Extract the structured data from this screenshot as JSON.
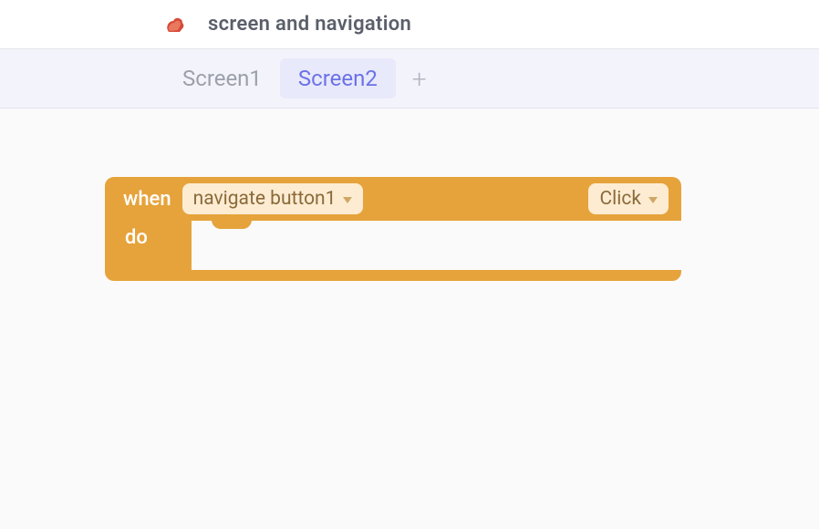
{
  "header": {
    "title": "screen and navigation"
  },
  "tabs": {
    "items": [
      {
        "label": "Screen1",
        "active": false
      },
      {
        "label": "Screen2",
        "active": true
      }
    ],
    "add_label": "+"
  },
  "block": {
    "when_label": "when",
    "do_label": "do",
    "component_dropdown": "navigate button1",
    "event_dropdown": "Click"
  },
  "colors": {
    "block_orange": "#e6a33b",
    "pill_bg": "#fdecd2",
    "pill_text": "#8a6a3a",
    "tab_active_text": "#6b72e8",
    "tab_active_bg": "#e8e9fa",
    "tab_inactive_text": "#9ca0ab"
  }
}
